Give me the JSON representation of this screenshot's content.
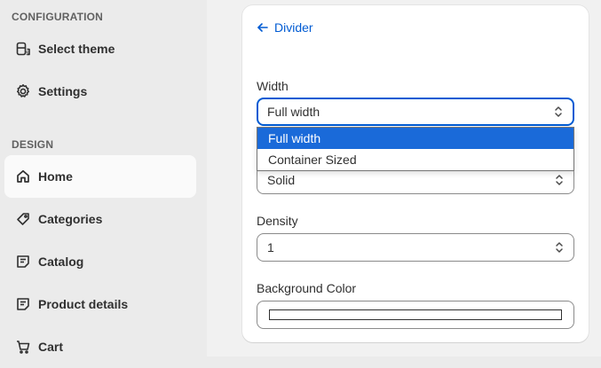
{
  "sidebar": {
    "sections": [
      {
        "header": "CONFIGURATION",
        "items": [
          {
            "label": "Select theme",
            "icon": "theme-icon"
          },
          {
            "label": "Settings",
            "icon": "gear-icon"
          }
        ]
      },
      {
        "header": "DESIGN",
        "items": [
          {
            "label": "Home",
            "icon": "home-icon",
            "active": true
          },
          {
            "label": "Categories",
            "icon": "tag-icon"
          },
          {
            "label": "Catalog",
            "icon": "catalog-icon"
          },
          {
            "label": "Product details",
            "icon": "product-details-icon"
          },
          {
            "label": "Cart",
            "icon": "cart-icon"
          }
        ]
      }
    ]
  },
  "panel": {
    "back_label": "Divider",
    "width": {
      "label": "Width",
      "value": "Full width",
      "options": [
        {
          "label": "Full width",
          "selected": true
        },
        {
          "label": "Container Sized",
          "selected": false
        }
      ]
    },
    "style": {
      "value": "Solid"
    },
    "density": {
      "label": "Density",
      "value": "1"
    },
    "background_color": {
      "label": "Background Color",
      "value": "#ffffff"
    }
  },
  "colors": {
    "accent": "#005bd3",
    "dropdown_selected": "#1a6ad9",
    "sidebar_bg": "#ebebeb",
    "active_item_bg": "#fafafa"
  }
}
